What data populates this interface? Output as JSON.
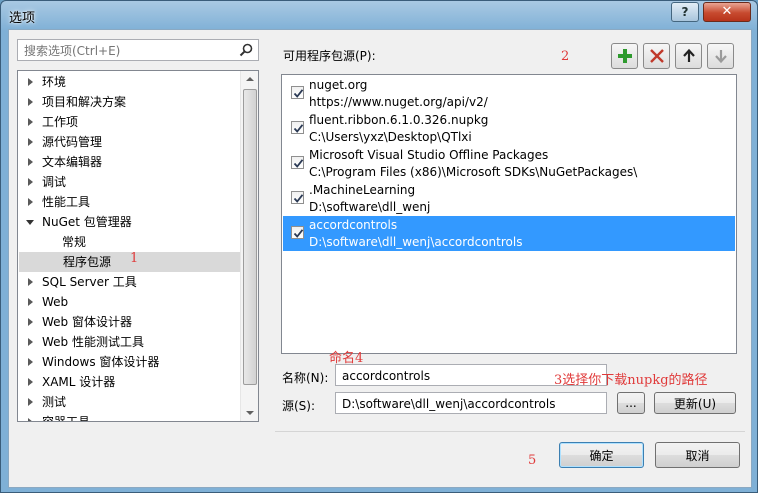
{
  "window": {
    "title": "选项",
    "help_label": "?",
    "close_label": "✕"
  },
  "search": {
    "placeholder": "搜索选项(Ctrl+E)"
  },
  "tree": {
    "items": [
      {
        "label": "环境",
        "expanded": false
      },
      {
        "label": "项目和解决方案",
        "expanded": false
      },
      {
        "label": "工作项",
        "expanded": false
      },
      {
        "label": "源代码管理",
        "expanded": false
      },
      {
        "label": "文本编辑器",
        "expanded": false
      },
      {
        "label": "调试",
        "expanded": false
      },
      {
        "label": "性能工具",
        "expanded": false
      },
      {
        "label": "NuGet 包管理器",
        "expanded": true
      },
      {
        "label": "常规",
        "child": true
      },
      {
        "label": "程序包源",
        "child": true,
        "selected": true
      },
      {
        "label": "SQL Server 工具",
        "expanded": false
      },
      {
        "label": "Web",
        "expanded": false
      },
      {
        "label": "Web 窗体设计器",
        "expanded": false
      },
      {
        "label": "Web 性能测试工具",
        "expanded": false
      },
      {
        "label": "Windows 窗体设计器",
        "expanded": false
      },
      {
        "label": "XAML 设计器",
        "expanded": false
      },
      {
        "label": "测试",
        "expanded": false
      },
      {
        "label": "容器工具",
        "expanded": false
      }
    ]
  },
  "sources": {
    "label": "可用程序包源(P):",
    "items": [
      {
        "name": "nuget.org",
        "url": "https://www.nuget.org/api/v2/",
        "checked": true
      },
      {
        "name": "fluent.ribbon.6.1.0.326.nupkg",
        "url": "C:\\Users\\yxz\\Desktop\\QTlxi",
        "checked": true
      },
      {
        "name": "Microsoft Visual Studio Offline Packages",
        "url": "C:\\Program Files (x86)\\Microsoft SDKs\\NuGetPackages\\",
        "checked": true
      },
      {
        "name": ".MachineLearning",
        "url": "D:\\software\\dll_wenj",
        "checked": true
      },
      {
        "name": "accordcontrols",
        "url": "D:\\software\\dll_wenj\\accordcontrols",
        "checked": true,
        "selected": true
      }
    ]
  },
  "form": {
    "name_label": "名称(N):",
    "name_value": "accordcontrols",
    "source_label": "源(S):",
    "source_value": "D:\\software\\dll_wenj\\accordcontrols",
    "browse_label": "...",
    "update_label": "更新(U)"
  },
  "buttons": {
    "ok": "确定",
    "cancel": "取消"
  },
  "annotations": {
    "a1": "1",
    "a2": "2",
    "a3": "3选择你下载nupkg的路径",
    "a4": "命名4",
    "a5": "5"
  },
  "colors": {
    "selection": "#3399ff",
    "add_icon": "#2e9a2e",
    "remove_icon": "#c0392b",
    "annotation": "#e03a3a"
  }
}
